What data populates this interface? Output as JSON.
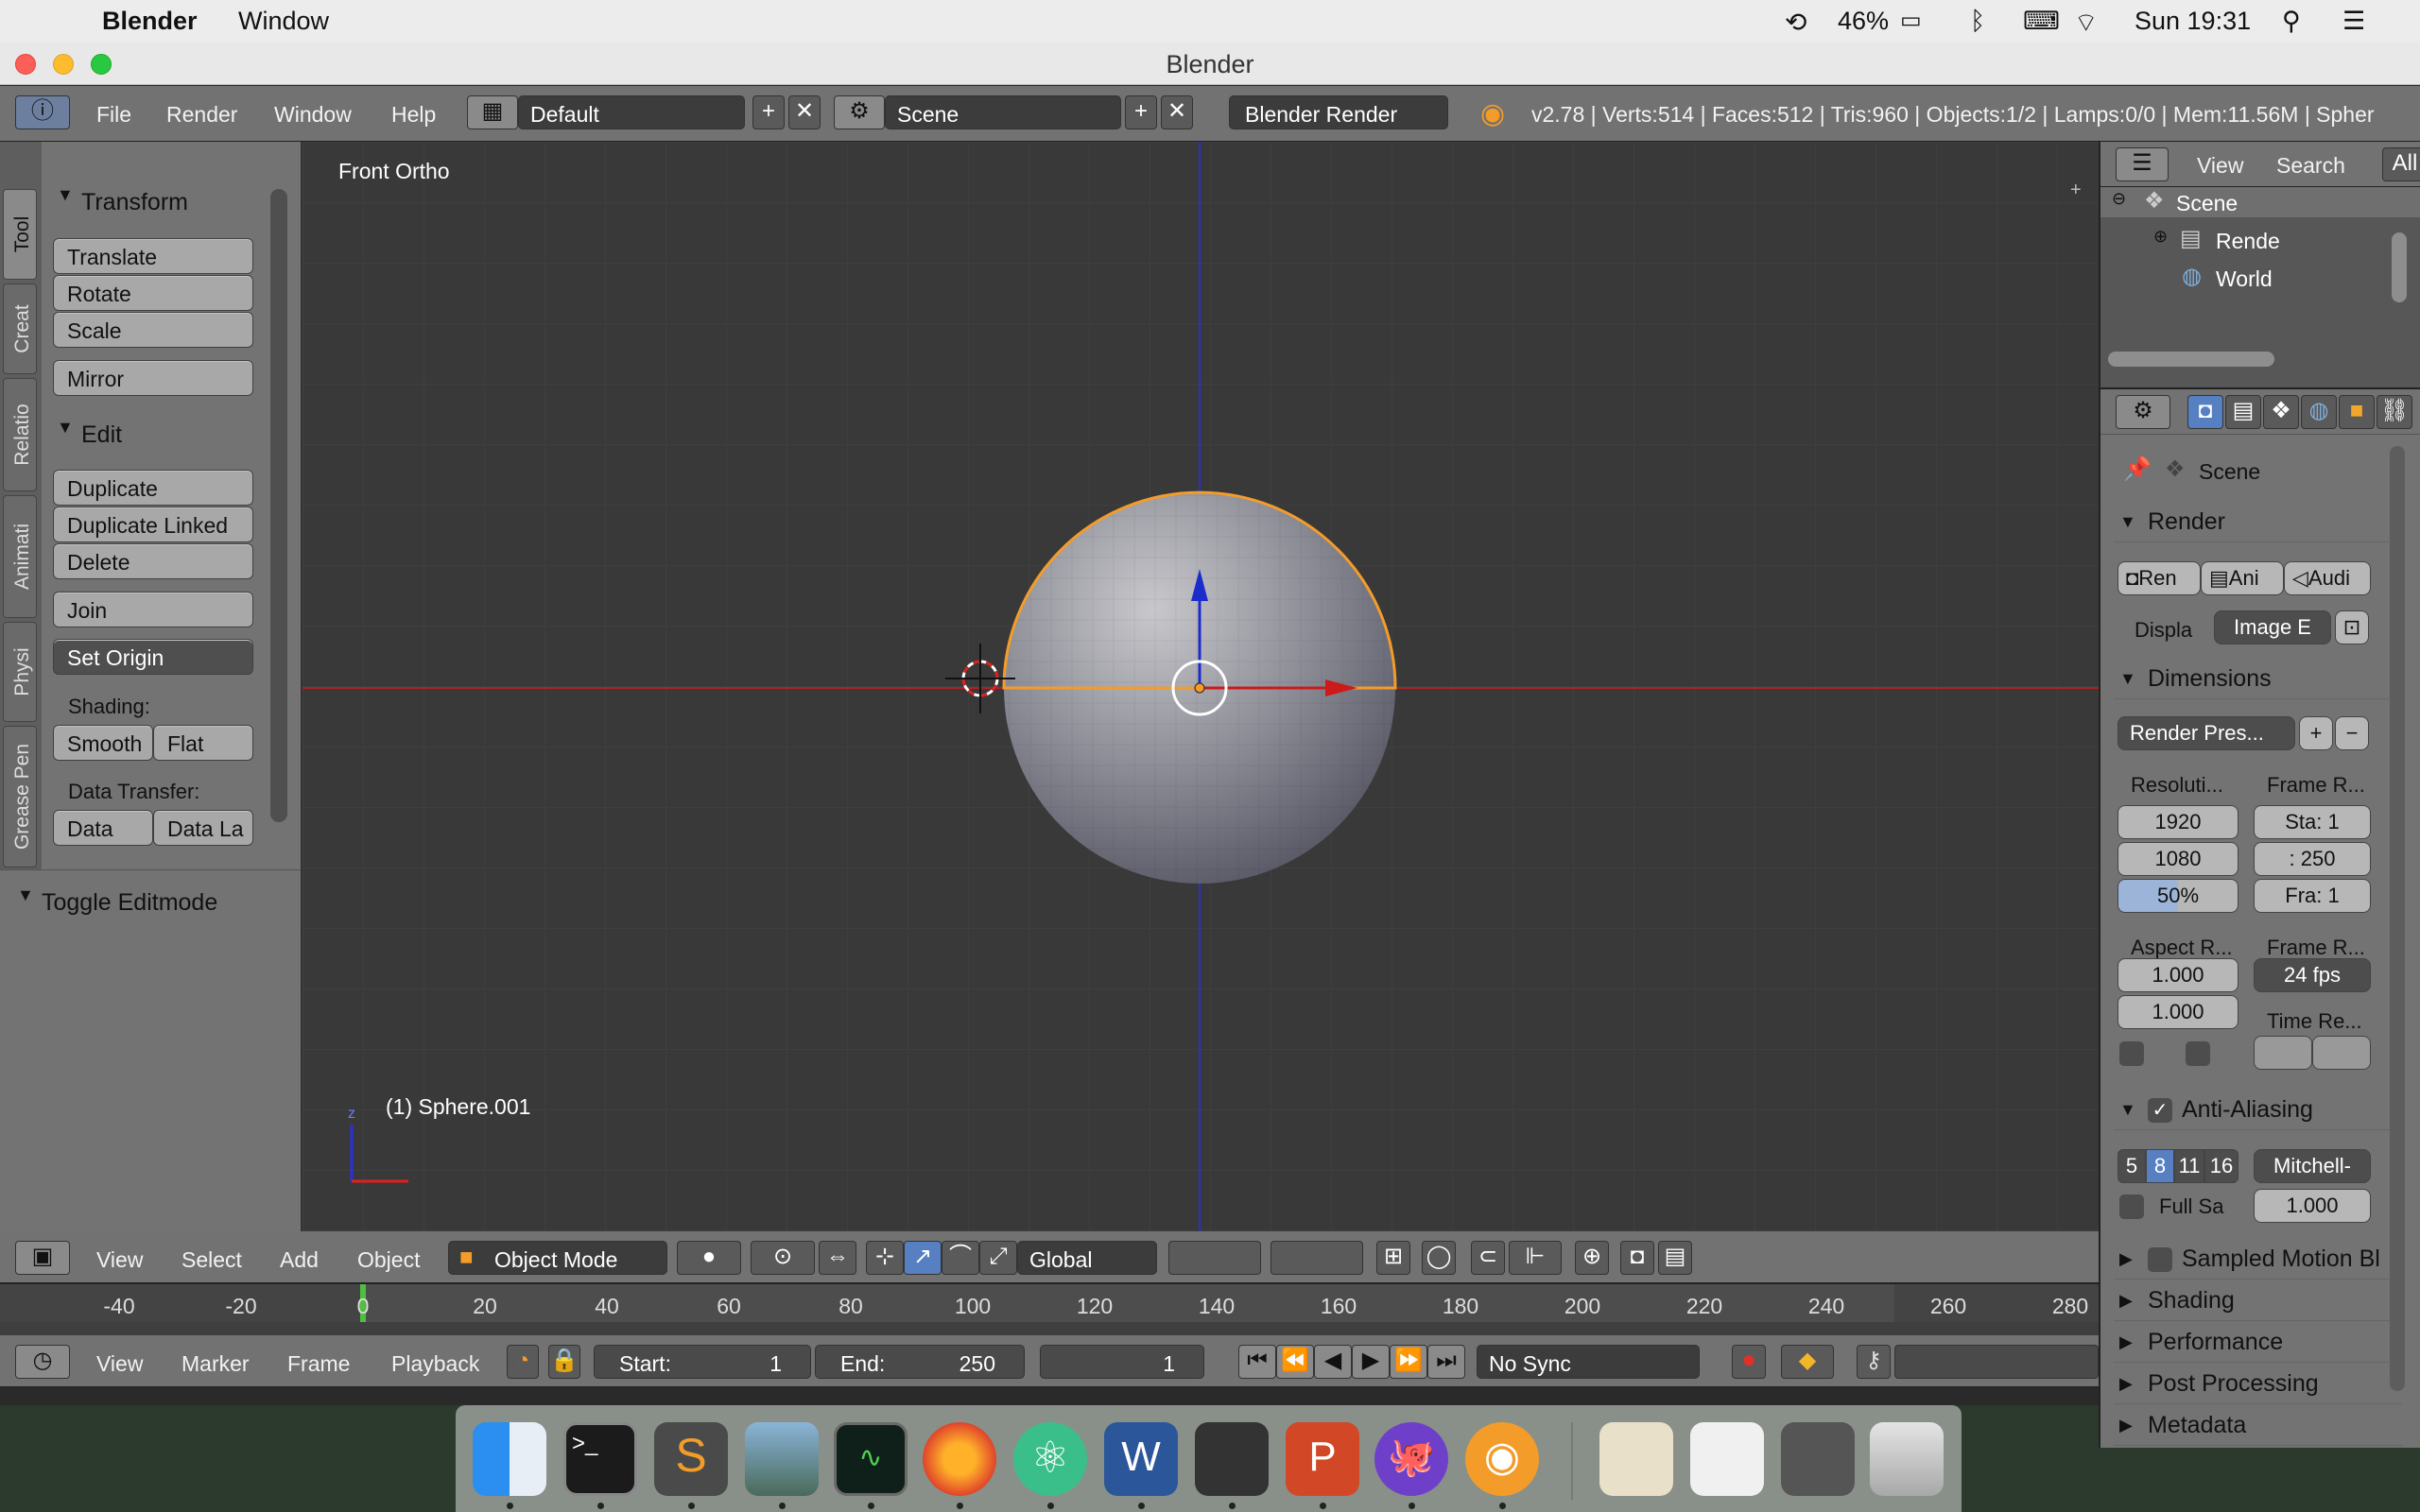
{
  "mac_menubar": {
    "app": "Blender",
    "menu": "Window",
    "battery": "46%",
    "clock": "Sun 19:31"
  },
  "window": {
    "title": "Blender"
  },
  "info_header": {
    "menus": [
      "File",
      "Render",
      "Window",
      "Help"
    ],
    "layout": "Default",
    "scene": "Scene",
    "engine": "Blender Render",
    "stats": "v2.78 | Verts:514 | Faces:512 | Tris:960 | Objects:1/2 | Lamps:0/0 | Mem:11.56M | Spher"
  },
  "tool_shelf": {
    "tabs": [
      "Tool",
      "Creat",
      "Relatio",
      "Animati",
      "Physi",
      "Grease Pen"
    ],
    "transform": {
      "title": "Transform",
      "buttons": [
        "Translate",
        "Rotate",
        "Scale",
        "Mirror"
      ]
    },
    "edit": {
      "title": "Edit",
      "buttons": [
        "Duplicate",
        "Duplicate Linked",
        "Delete",
        "Join"
      ],
      "set_origin": "Set Origin",
      "shading_label": "Shading:",
      "smooth": "Smooth",
      "flat": "Flat",
      "data_transfer_label": "Data Transfer:",
      "data": "Data",
      "data_la": "Data La"
    },
    "toggle_editmode": "Toggle Editmode"
  },
  "viewport": {
    "label": "Front Ortho",
    "object_label": "(1) Sphere.001",
    "axis_z": "z"
  },
  "view_header": {
    "menus": [
      "View",
      "Select",
      "Add",
      "Object"
    ],
    "mode": "Object Mode",
    "orientation": "Global"
  },
  "timeline": {
    "ticks": [
      "-40",
      "-20",
      "0",
      "20",
      "40",
      "60",
      "80",
      "100",
      "120",
      "140",
      "160",
      "180",
      "200",
      "220",
      "240",
      "260",
      "280"
    ]
  },
  "timeline_header": {
    "menus": [
      "View",
      "Marker",
      "Frame",
      "Playback"
    ],
    "start_label": "Start:",
    "start": "1",
    "end_label": "End:",
    "end": "250",
    "current": "1",
    "sync": "No Sync"
  },
  "outliner": {
    "menus": [
      "View",
      "Search"
    ],
    "filter": "All",
    "items": [
      "Scene",
      "Rende",
      "World"
    ]
  },
  "properties": {
    "scene": "Scene",
    "render": {
      "title": "Render",
      "buttons": [
        "Ren",
        "Ani",
        "Audi"
      ],
      "display_label": "Displa",
      "display": "Image E"
    },
    "dimensions": {
      "title": "Dimensions",
      "preset": "Render Pres...",
      "res_label": "Resoluti...",
      "frame_range_label": "Frame R...",
      "res_x": "1920",
      "res_y": "1080",
      "res_pct": "50%",
      "start": "Sta: 1",
      "end": ":  250",
      "frame": "Fra: 1",
      "aspect_label": "Aspect R...",
      "frame_rate_label": "Frame R...",
      "aspect_x": "1.000",
      "aspect_y": "1.000",
      "fps": "24 fps",
      "time_remap": "Time Re..."
    },
    "anti_aliasing": {
      "title": "Anti-Aliasing",
      "samples": [
        "5",
        "8",
        "11",
        "16"
      ],
      "filter": "Mitchell-",
      "full_sample": "Full Sa",
      "size": "1.000"
    },
    "sampled_motion": "Sampled Motion Bl",
    "collapsed": [
      "Shading",
      "Performance",
      "Post Processing",
      "Metadata"
    ]
  },
  "colors": {
    "selected": "#f39c2a",
    "x_axis": "#cc1a1a",
    "z_axis": "#1a2ccc",
    "accent": "#5680c2"
  }
}
